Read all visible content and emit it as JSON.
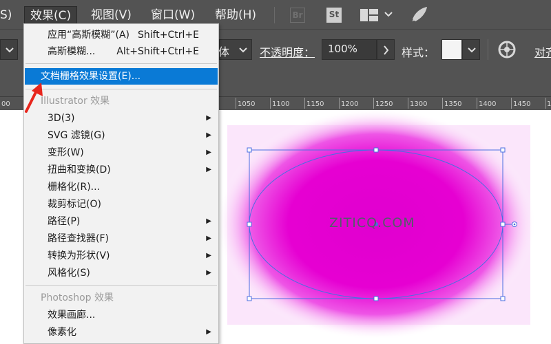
{
  "menubar": {
    "items": [
      "S)",
      "效果(C)",
      "视图(V)",
      "窗口(W)",
      "帮助(H)"
    ],
    "app_buttons": [
      "Br",
      "St"
    ]
  },
  "controlbar": {
    "font_partial": "体",
    "opacity_label": "不透明度：",
    "opacity_value": "100%",
    "style_label": "样式：",
    "align_partial": "对齐"
  },
  "ruler": {
    "ticks": [
      "00",
      "1050",
      "1100",
      "1150",
      "1200",
      "1250",
      "1300",
      "1350",
      "1400",
      "1450",
      "1"
    ]
  },
  "effect_menu": {
    "items": [
      {
        "label": "应用“高斯模糊”(A)",
        "shortcut": "Shift+Ctrl+E"
      },
      {
        "label": "高斯模糊...",
        "shortcut": "Alt+Shift+Ctrl+E"
      },
      {
        "label": "文档栅格效果设置(E)...",
        "highlighted": true
      },
      {
        "label": "Illustrator 效果",
        "header": true
      },
      {
        "label": "3D(3)",
        "submenu": true
      },
      {
        "label": "SVG 滤镜(G)",
        "submenu": true
      },
      {
        "label": "变形(W)",
        "submenu": true
      },
      {
        "label": "扭曲和变换(D)",
        "submenu": true
      },
      {
        "label": "栅格化(R)..."
      },
      {
        "label": "裁剪标记(O)"
      },
      {
        "label": "路径(P)",
        "submenu": true
      },
      {
        "label": "路径查找器(F)",
        "submenu": true
      },
      {
        "label": "转换为形状(V)",
        "submenu": true
      },
      {
        "label": "风格化(S)",
        "submenu": true
      },
      {
        "label": "Photoshop 效果",
        "header": true
      },
      {
        "label": "效果画廊..."
      },
      {
        "label": "像素化",
        "submenu": true
      }
    ]
  },
  "canvas": {
    "watermark": "ZITICQ.COM",
    "ellipse_fill": "#e600d2",
    "glow_color": "#f5b8f5",
    "selection_color": "#4a6fe0"
  }
}
